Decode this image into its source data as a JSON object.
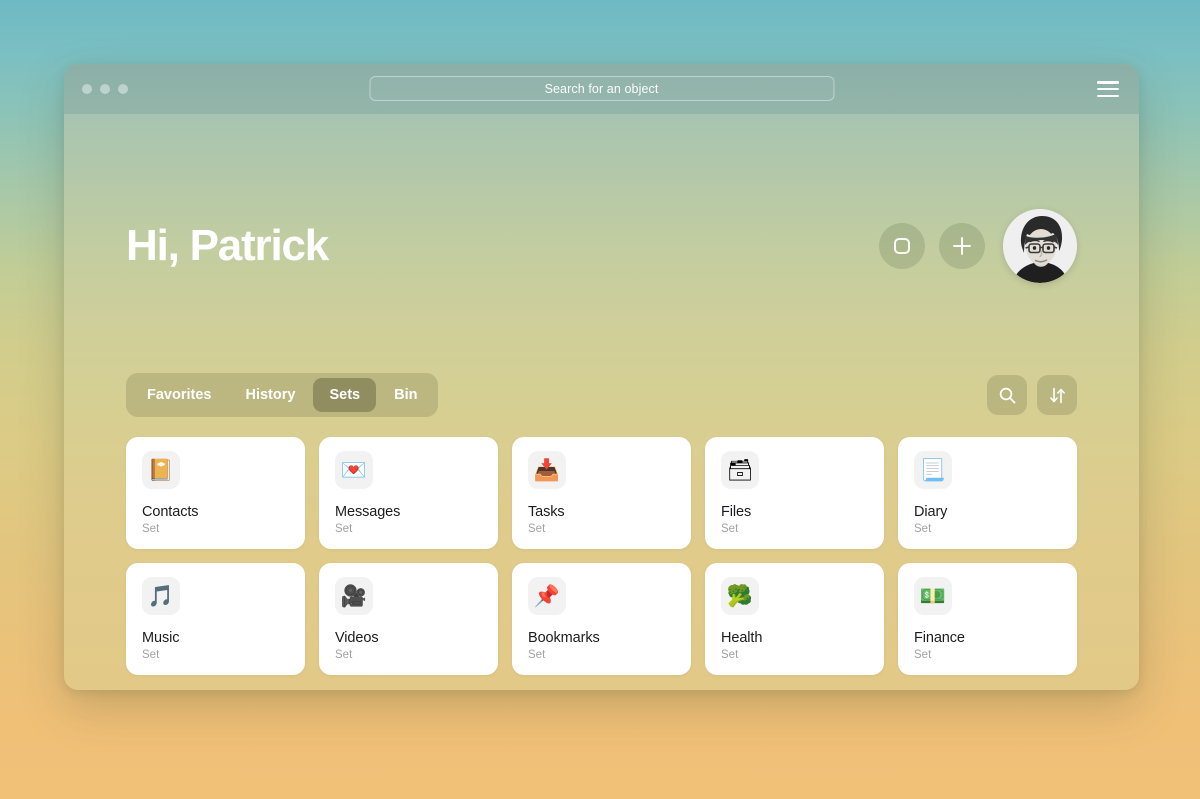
{
  "background": {
    "gradient_top": "#6fb9c4",
    "gradient_mid": "#cfcd92",
    "gradient_bottom": "#f2c178"
  },
  "window": {
    "titlebar": {
      "traffic_lights": [
        "close-dot",
        "minimize-dot",
        "maximize-dot"
      ],
      "search": {
        "value": "Search for an object",
        "placeholder": "Search for an object"
      },
      "menu_icon": "hamburger-menu-icon"
    },
    "hero": {
      "greeting": "Hi, Patrick",
      "actions": [
        {
          "name": "rounded-square-button",
          "icon": "rounded-square-icon"
        },
        {
          "name": "add-button",
          "icon": "plus-icon"
        }
      ],
      "avatar": {
        "name": "user-avatar",
        "alt": "Patrick"
      }
    },
    "toolbar": {
      "tabs": [
        {
          "label": "Favorites",
          "active": false
        },
        {
          "label": "History",
          "active": false
        },
        {
          "label": "Sets",
          "active": true
        },
        {
          "label": "Bin",
          "active": false
        }
      ],
      "buttons": [
        {
          "name": "search-button",
          "icon": "search-icon"
        },
        {
          "name": "sort-button",
          "icon": "sort-arrows-icon"
        }
      ]
    },
    "grid": {
      "cards": [
        {
          "title": "Contacts",
          "subtitle": "Set",
          "icon": "📔",
          "icon_name": "notebook-icon"
        },
        {
          "title": "Messages",
          "subtitle": "Set",
          "icon": "💌",
          "icon_name": "love-letter-icon"
        },
        {
          "title": "Tasks",
          "subtitle": "Set",
          "icon": "📥",
          "icon_name": "inbox-tray-icon"
        },
        {
          "title": "Files",
          "subtitle": "Set",
          "icon": "🗃",
          "icon_name": "card-file-box-icon"
        },
        {
          "title": "Diary",
          "subtitle": "Set",
          "icon": "📃",
          "icon_name": "page-with-curl-icon"
        },
        {
          "title": "Music",
          "subtitle": "Set",
          "icon": "🎵",
          "icon_name": "musical-note-icon"
        },
        {
          "title": "Videos",
          "subtitle": "Set",
          "icon": "🎥",
          "icon_name": "movie-camera-icon"
        },
        {
          "title": "Bookmarks",
          "subtitle": "Set",
          "icon": "📌",
          "icon_name": "pushpin-icon"
        },
        {
          "title": "Health",
          "subtitle": "Set",
          "icon": "🥦",
          "icon_name": "broccoli-icon"
        },
        {
          "title": "Finance",
          "subtitle": "Set",
          "icon": "💵",
          "icon_name": "banknote-icon"
        }
      ]
    }
  }
}
